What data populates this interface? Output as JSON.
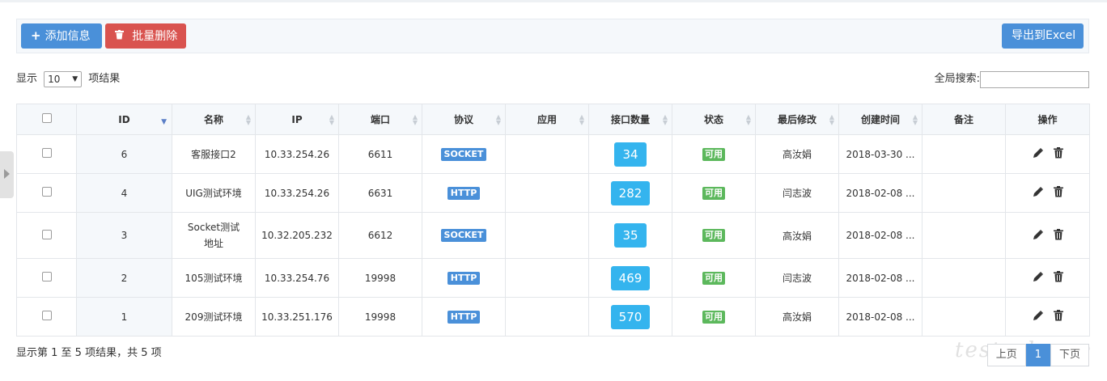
{
  "toolbar": {
    "add_label": "添加信息",
    "add_icon": "plus-icon",
    "delete_label": "批量删除",
    "delete_icon": "trash-icon",
    "export_label": "导出到Excel"
  },
  "length_menu": {
    "prefix": "显示",
    "value": "10",
    "suffix": "项结果"
  },
  "search": {
    "label": "全局搜索:",
    "value": ""
  },
  "table": {
    "headers": [
      "ID",
      "名称",
      "IP",
      "端口",
      "协议",
      "应用",
      "接口数量",
      "状态",
      "最后修改",
      "创建时间",
      "备注",
      "操作"
    ],
    "rows": [
      {
        "id": "6",
        "name": "客服接口2",
        "ip": "10.33.254.26",
        "port": "6611",
        "protocol": "SOCKET",
        "app": "",
        "count": "34",
        "status": "可用",
        "modifier": "高汝娟",
        "created": "2018-03-30 ...",
        "remark": ""
      },
      {
        "id": "4",
        "name": "UIG测试环境",
        "ip": "10.33.254.26",
        "port": "6631",
        "protocol": "HTTP",
        "app": "",
        "count": "282",
        "status": "可用",
        "modifier": "闫志波",
        "created": "2018-02-08 ...",
        "remark": ""
      },
      {
        "id": "3",
        "name": "Socket测试地址",
        "ip": "10.32.205.232",
        "port": "6612",
        "protocol": "SOCKET",
        "app": "",
        "count": "35",
        "status": "可用",
        "modifier": "高汝娟",
        "created": "2018-02-08 ...",
        "remark": ""
      },
      {
        "id": "2",
        "name": "105测试环境",
        "ip": "10.33.254.76",
        "port": "19998",
        "protocol": "HTTP",
        "app": "",
        "count": "469",
        "status": "可用",
        "modifier": "闫志波",
        "created": "2018-02-08 ...",
        "remark": ""
      },
      {
        "id": "1",
        "name": "209测试环境",
        "ip": "10.33.251.176",
        "port": "19998",
        "protocol": "HTTP",
        "app": "",
        "count": "570",
        "status": "可用",
        "modifier": "高汝娟",
        "created": "2018-02-08 ...",
        "remark": ""
      }
    ]
  },
  "footer": {
    "info": "显示第 1 至 5 项结果，共 5 项",
    "prev": "上页",
    "current": "1",
    "next": "下页"
  },
  "watermark": "testerhome",
  "colors": {
    "primary": "#4a90d9",
    "danger": "#d9534f",
    "count_badge": "#34b4ee",
    "status_ok": "#5cb85c"
  }
}
